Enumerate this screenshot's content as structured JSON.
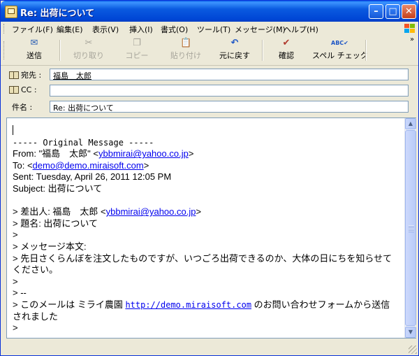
{
  "window": {
    "title": "Re: 出荷について"
  },
  "menu": [
    "ファイル(F)",
    "編集(E)",
    "表示(V)",
    "挿入(I)",
    "書式(O)",
    "ツール(T)",
    "メッセージ(M)",
    "ヘルプ(H)"
  ],
  "toolbar": {
    "send": "送信",
    "cut": "切り取り",
    "copy": "コピー",
    "paste": "貼り付け",
    "undo": "元に戻す",
    "check": "確認",
    "spell": "スペル チェック"
  },
  "headers": {
    "to_label": "宛先 :",
    "to_value": "福島　太郎",
    "cc_label": "CC :",
    "cc_value": "",
    "subject_label": "件名 :",
    "subject_value": "Re: 出荷について"
  },
  "body": {
    "original_header": "----- Original Message -----",
    "from_label": "From: ",
    "from_name": "\"福島　太郎\" <",
    "from_email": "ybbmirai@yahoo.co.jp",
    "from_close": ">",
    "to_label": "To: <",
    "to_email": "demo@demo.miraisoft.com",
    "to_close": ">",
    "sent": "Sent: Tuesday, April 26, 2011 12:05 PM",
    "subject": "Subject: 出荷について",
    "q1_prefix": "> 差出人: 福島　太郎 <",
    "q1_email": "ybbmirai@yahoo.co.jp",
    "q1_close": ">",
    "q2": "> 題名: 出荷について",
    "q3": ">",
    "q4": "> メッセージ本文:",
    "q5": "> 先日さくらんぼを注文したものですが、いつごろ出荷できるのか、大体の日にちを知らせてください。",
    "q6": ">",
    "q7": "> --",
    "q8_prefix": "> このメールは ミライ農園 ",
    "q8_url": "http://demo.miraisoft.com",
    "q8_suffix": " のお問い合わせフォームから送信されました",
    "q9": ">"
  },
  "colors": {
    "titlebar": "#0054e3",
    "chrome": "#ece9d8",
    "link": "#0000ee",
    "field_border": "#7f9db9"
  }
}
